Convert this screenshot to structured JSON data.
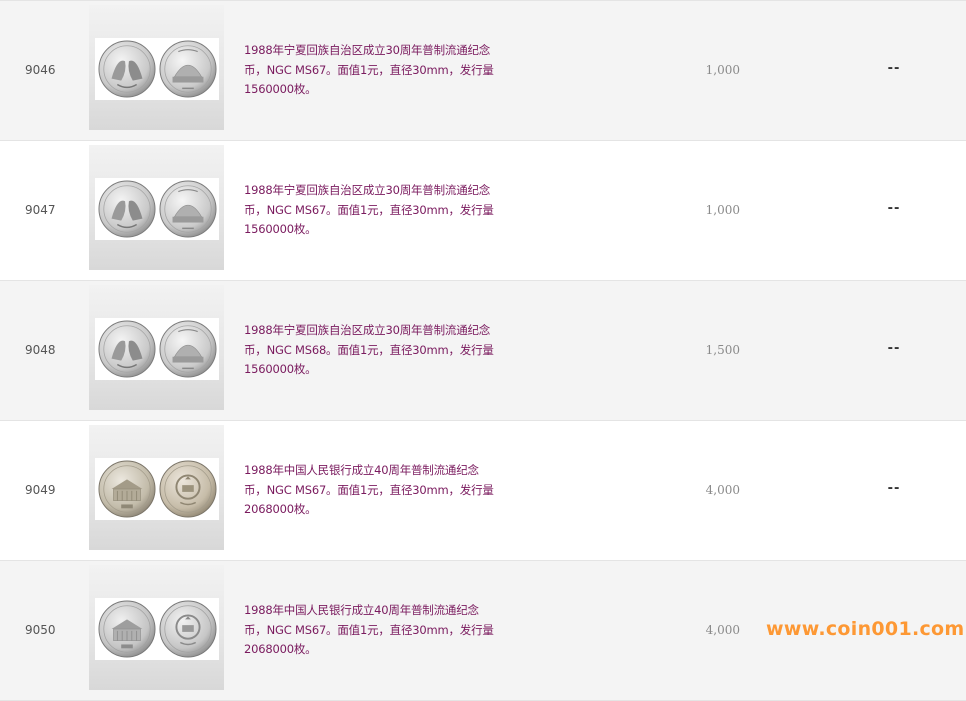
{
  "colors": {
    "description_text": "#7a1a5e",
    "estimate_text": "#8a8a8a",
    "row_alt_bg": "#f4f4f4",
    "watermark": "#ff8c1a"
  },
  "lots": [
    {
      "number": "9046",
      "desc_line1": "1988年宁夏回族自治区成立30周年普制流通纪念",
      "desc_line2": "币，NGC MS67。面值1元，直径30mm，发行量",
      "desc_line3": "1560000枚。",
      "estimate": "1,000",
      "result": "--",
      "coin_obverse_icon": "ningxia-two-figures-coin-icon",
      "coin_reverse_icon": "ningxia-mosque-coin-icon"
    },
    {
      "number": "9047",
      "desc_line1": "1988年宁夏回族自治区成立30周年普制流通纪念",
      "desc_line2": "币，NGC MS67。面值1元，直径30mm，发行量",
      "desc_line3": "1560000枚。",
      "estimate": "1,000",
      "result": "--",
      "coin_obverse_icon": "ningxia-two-figures-coin-icon",
      "coin_reverse_icon": "ningxia-mosque-coin-icon"
    },
    {
      "number": "9048",
      "desc_line1": "1988年宁夏回族自治区成立30周年普制流通纪念",
      "desc_line2": "币，NGC MS68。面值1元，直径30mm，发行量",
      "desc_line3": "1560000枚。",
      "estimate": "1,500",
      "result": "--",
      "coin_obverse_icon": "ningxia-two-figures-coin-icon",
      "coin_reverse_icon": "ningxia-mosque-coin-icon"
    },
    {
      "number": "9049",
      "desc_line1": "1988年中国人民银行成立40周年普制流通纪念",
      "desc_line2": "币，NGC MS67。面值1元，直径30mm，发行量",
      "desc_line3": "2068000枚。",
      "estimate": "4,000",
      "result": "--",
      "coin_obverse_icon": "pboc-building-coin-icon",
      "coin_reverse_icon": "national-emblem-coin-icon"
    },
    {
      "number": "9050",
      "desc_line1": "1988年中国人民银行成立40周年普制流通纪念",
      "desc_line2": "币，NGC MS67。面值1元，直径30mm，发行量",
      "desc_line3": "2068000枚。",
      "estimate": "4,000",
      "result": "",
      "coin_obverse_icon": "pboc-building-coin-icon",
      "coin_reverse_icon": "national-emblem-coin-icon"
    }
  ],
  "watermark": "www.coin001.com"
}
